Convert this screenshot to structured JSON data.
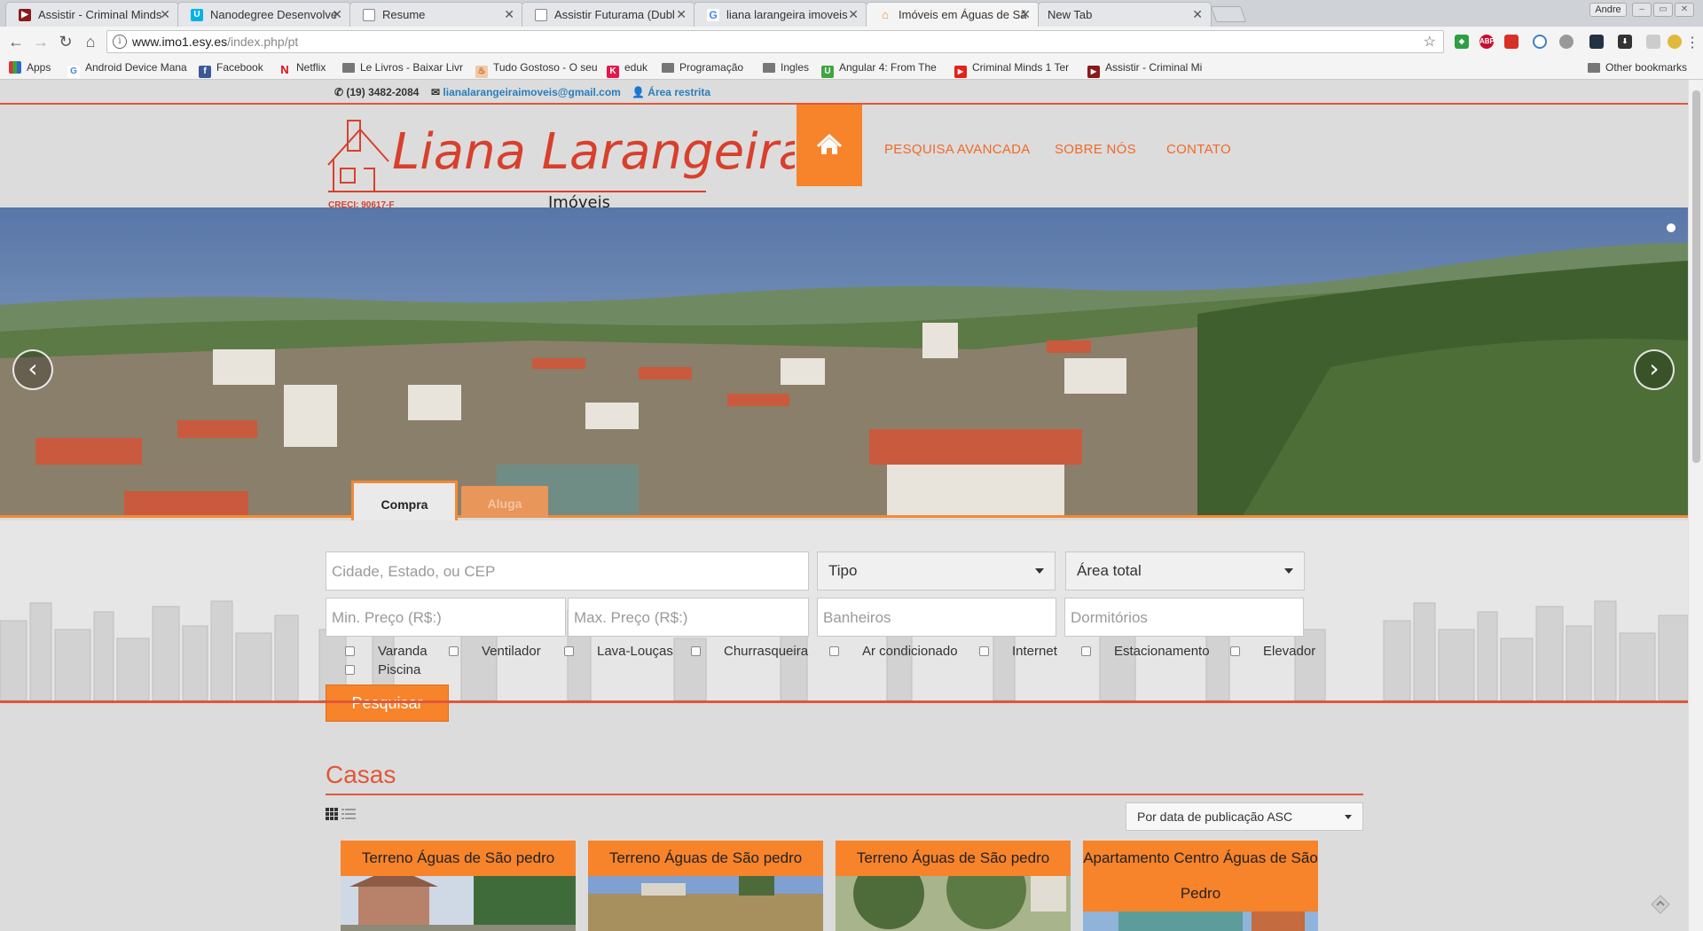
{
  "browser": {
    "tabs": [
      {
        "title": "Assistir - Criminal Minds",
        "icon": "red-play-icon",
        "color": "#8b1a1a"
      },
      {
        "title": "Nanodegree Desenvolve",
        "icon": "udacity-icon",
        "color": "#02b3e4"
      },
      {
        "title": "Resume",
        "icon": "document-icon",
        "color": "#777777"
      },
      {
        "title": "Assistir Futurama (Dubl",
        "icon": "document-icon",
        "color": "#777777"
      },
      {
        "title": "liana larangeira imoveis",
        "icon": "google-icon",
        "color": "#4285f4"
      },
      {
        "title": "Imóveis em Águas de Sã",
        "icon": "house-icon",
        "color": "#f28a36",
        "active": true
      },
      {
        "title": "New Tab",
        "icon": "",
        "color": ""
      }
    ],
    "user": "Andre",
    "url_host": "www.imo1.esy.es",
    "url_path": "/index.php/pt",
    "bookmarks": [
      {
        "label": "Apps",
        "icon": "apps-icon"
      },
      {
        "label": "Android Device Mana",
        "icon": "google-icon"
      },
      {
        "label": "Facebook",
        "icon": "facebook-icon"
      },
      {
        "label": "Netflix",
        "icon": "netflix-icon"
      },
      {
        "label": "Le Livros - Baixar Livr",
        "icon": "folder-icon"
      },
      {
        "label": "Tudo Gostoso - O seu",
        "icon": "chef-hat-icon"
      },
      {
        "label": "eduk",
        "icon": "eduk-icon"
      },
      {
        "label": "Programação",
        "icon": "folder-icon"
      },
      {
        "label": "Ingles",
        "icon": "folder-icon"
      },
      {
        "label": "Angular 4: From The",
        "icon": "udemy-icon"
      },
      {
        "label": "Criminal Minds 1 Ter",
        "icon": "youtube-icon"
      },
      {
        "label": "Assistir - Criminal Mi",
        "icon": "red-play-icon"
      }
    ],
    "other_bookmarks": "Other bookmarks"
  },
  "site": {
    "phone": "(19) 3482-2084",
    "email": "lianalarangeiraimoveis@gmail.com",
    "restricted": "Área restrita",
    "logo_name": "Liana Larangeira",
    "logo_sub": "Imóveis",
    "creci": "CRECI: 90617-F",
    "nav": [
      "PESQUISA AVANCADA",
      "SOBRE NÓS",
      "CONTATO"
    ],
    "tabs": {
      "buy": "Compra",
      "rent": "Aluga"
    },
    "search": {
      "location_placeholder": "Cidade, Estado, ou CEP",
      "type": "Tipo",
      "area": "Área total",
      "min_price": "Min. Preço (R$:)",
      "max_price": "Max. Preço (R$:)",
      "bathrooms": "Banheiros",
      "bedrooms": "Dormitórios",
      "features": [
        "Varanda",
        "Ventilador",
        "Lava-Louças",
        "Churrasqueira",
        "Ar condicionado",
        "Internet",
        "Estacionamento",
        "Elevador",
        "Piscina"
      ],
      "button": "Pesquisar"
    },
    "listing": {
      "title": "Casas",
      "sort": "Por data de publicação ASC",
      "cards": [
        "Terreno Águas de São pedro",
        "Terreno Águas de São pedro",
        "Terreno Águas de São pedro",
        "Apartamento Centro Águas de São Pedro"
      ]
    },
    "colors": {
      "accent": "#f7832a",
      "red": "#e0573a",
      "link": "#2a7dbd"
    }
  }
}
